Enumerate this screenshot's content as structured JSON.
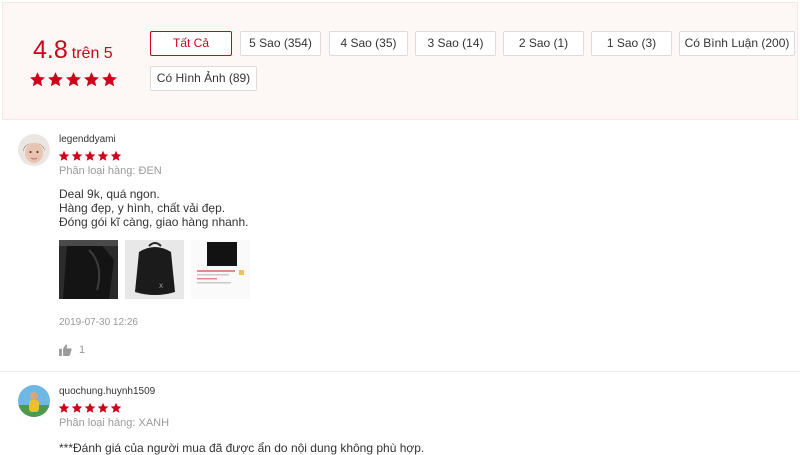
{
  "summary": {
    "rating": "4.8",
    "rating_suffix": "trên 5",
    "stars": 5,
    "star_color": "#d0011b"
  },
  "filters": [
    {
      "label": "Tất Cả",
      "active": true
    },
    {
      "label": "5 Sao (354)",
      "active": false
    },
    {
      "label": "4 Sao (35)",
      "active": false
    },
    {
      "label": "3 Sao (14)",
      "active": false
    },
    {
      "label": "2 Sao (1)",
      "active": false
    },
    {
      "label": "1 Sao (3)",
      "active": false
    },
    {
      "label": "Có Bình Luận (200)",
      "active": false
    },
    {
      "label": "Có Hình Ảnh (89)",
      "active": false
    }
  ],
  "reviews": [
    {
      "username": "legenddyami",
      "stars": 5,
      "variant": "Phân loại hàng: ĐEN",
      "lines": [
        "Deal 9k, quá ngon.",
        "Hàng đẹp, y hình, chất vải đẹp.",
        "Đóng gói kĩ càng, giao hàng nhanh."
      ],
      "photos": 3,
      "date": "2019-07-30 12:26",
      "likes": "1"
    },
    {
      "username": "quochung.huynh1509",
      "stars": 5,
      "variant": "Phân loại hàng: XANH",
      "hidden_note": "***Đánh giá của người mua đã được ẩn do nội dung không phù hợp."
    }
  ]
}
